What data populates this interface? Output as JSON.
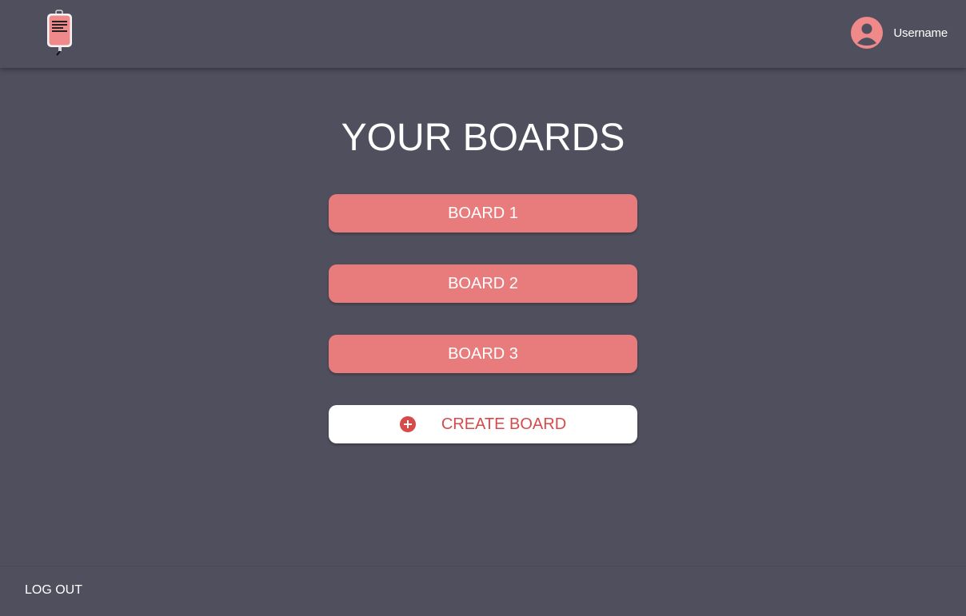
{
  "header": {
    "logo_icon": "iv-bag-logo-icon",
    "user": {
      "avatar_icon": "user-avatar-icon",
      "name": "Username"
    }
  },
  "main": {
    "title": "YOUR BOARDS",
    "boards": [
      {
        "label": "BOARD 1"
      },
      {
        "label": "BOARD 2"
      },
      {
        "label": "BOARD 3"
      }
    ],
    "create_button": {
      "icon": "plus-circle-icon",
      "label": "CREATE BOARD"
    }
  },
  "footer": {
    "logout_label": "LOG OUT"
  },
  "colors": {
    "background": "#4f4f5d",
    "board_button": "#e87c7c",
    "create_text": "#d84a4a",
    "avatar": "#f08a8a"
  }
}
